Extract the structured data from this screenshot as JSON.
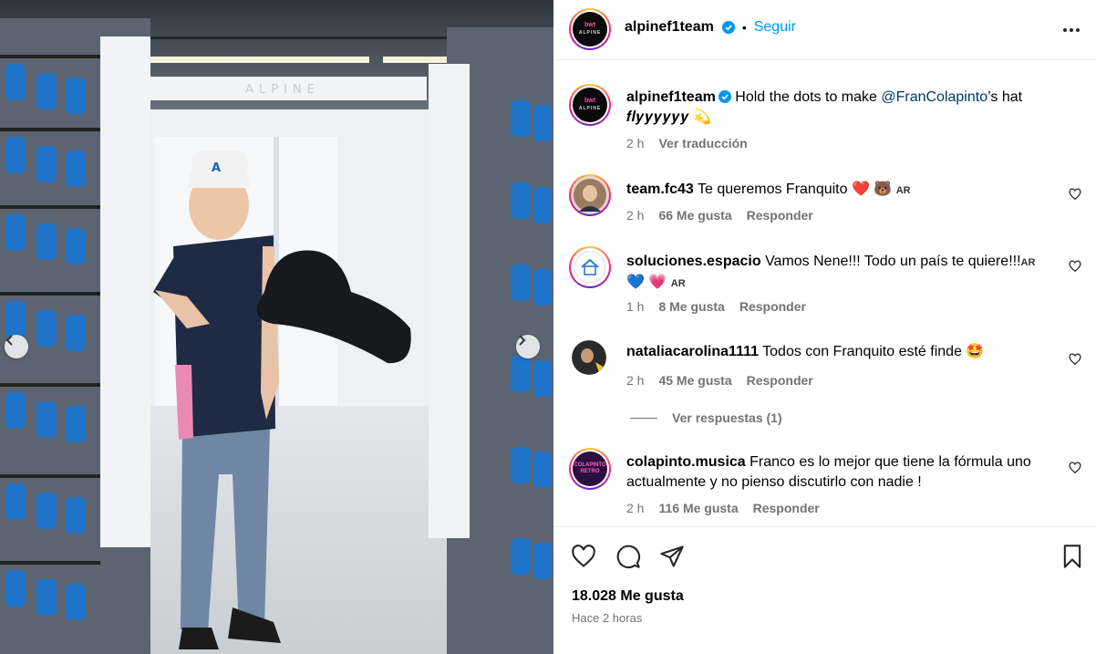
{
  "post": {
    "author": "alpinef1team",
    "follow_label": "Seguir",
    "caption_user": "alpinef1team",
    "caption_pre": "Hold the dots to make ",
    "caption_mention": "@FranColapinto",
    "caption_post": "’s hat",
    "caption_line2": "𝒇𝒍𝒚𝒚𝒚𝒚𝒚𝒚 ",
    "caption_emoji": "💫",
    "caption_time": "2 h",
    "translate_label": "Ver traducción",
    "photo_signage": "ALPINE",
    "avatar_logo_main": "bwt",
    "avatar_logo_sub": "ALPINE"
  },
  "comments": [
    {
      "user": "team.fc43",
      "text": "Te queremos Franquito ❤️ 🐻",
      "flag": "AR",
      "time": "2 h",
      "likes": "66 Me gusta",
      "reply": "Responder"
    },
    {
      "user": "soluciones.espacio",
      "text": "Vamos Nene!!! Todo un país te quiere!!!",
      "flag": "AR",
      "text2": "💙 💗",
      "flag2": "AR",
      "time": "1 h",
      "likes": "8 Me gusta",
      "reply": "Responder"
    },
    {
      "user": "nataliacarolina1111",
      "text": "Todos con Franquito esté finde 🤩",
      "time": "2 h",
      "likes": "45 Me gusta",
      "reply": "Responder",
      "view_replies": "Ver respuestas (1)"
    },
    {
      "user": "colapinto.musica",
      "text": "Franco es lo mejor que tiene la fórmula uno actualmente y no pienso discutirlo con nadie !",
      "time": "2 h",
      "likes": "116 Me gusta",
      "reply": "Responder",
      "avatar_text": "COLAPINTO RETRO"
    }
  ],
  "footer": {
    "likes": "18.028 Me gusta",
    "time": "Hace 2 horas"
  },
  "colors": {
    "link": "#0095f6",
    "mention": "#00376b",
    "muted": "#737373",
    "verified": "#0095f6"
  },
  "icons": [
    "chevron-left-icon",
    "chevron-right-icon",
    "verified-badge-icon",
    "more-icon",
    "heart-icon",
    "comment-icon",
    "share-icon",
    "bookmark-icon"
  ]
}
